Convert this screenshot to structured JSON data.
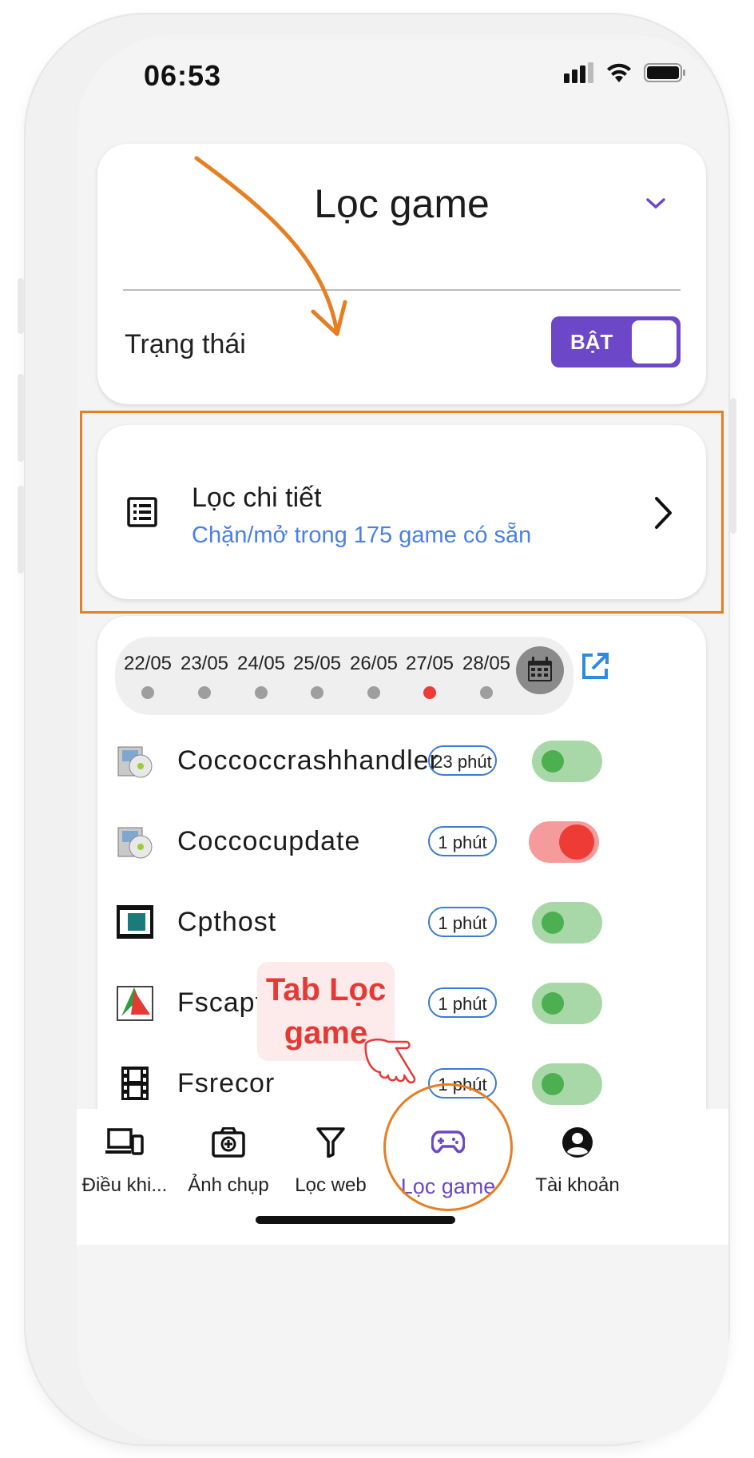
{
  "status_bar": {
    "time": "06:53"
  },
  "header_card": {
    "title": "Lọc game",
    "status_label": "Trạng thái",
    "toggle_label": "BẬT"
  },
  "detail_card": {
    "title": "Lọc chi tiết",
    "subtitle": "Chặn/mở trong 175 game có sẵn"
  },
  "date_bar": {
    "dates": [
      "22/05",
      "23/05",
      "24/05",
      "25/05",
      "26/05",
      "27/05",
      "28/05"
    ],
    "highlighted": "27/05"
  },
  "apps": [
    {
      "name": "Coccoccrashhandler",
      "time": "23 phút",
      "blocked": false
    },
    {
      "name": "Coccocupdate",
      "time": "1 phút",
      "blocked": true
    },
    {
      "name": "Cpthost",
      "time": "1 phút",
      "blocked": false
    },
    {
      "name": "Fscapture",
      "time": "1 phút",
      "blocked": false
    },
    {
      "name": "Fsrecor",
      "time": "1 phút",
      "blocked": false
    }
  ],
  "callout": {
    "line1": "Tab Lọc",
    "line2": "game"
  },
  "nav": [
    {
      "label": "Điều khi...",
      "icon": "devices-icon"
    },
    {
      "label": "Ảnh chụp",
      "icon": "camera-icon"
    },
    {
      "label": "Lọc web",
      "icon": "filter-icon"
    },
    {
      "label": "Lọc game",
      "icon": "gamepad-icon",
      "active": true
    },
    {
      "label": "Tài khoản",
      "icon": "account-icon"
    }
  ],
  "colors": {
    "accent": "#6c47c7",
    "link": "#4a7fe8",
    "annotation": "#e67e22",
    "block": "#ef3b36",
    "allow": "#4caf50"
  }
}
